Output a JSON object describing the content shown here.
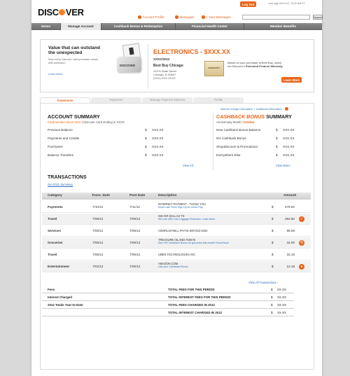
{
  "header": {
    "logo_text": "DISCOVER",
    "logout_label": "Log Out",
    "last_login": "Last login 04/11/12, 10:40 AM ET",
    "account_profile": "Account Profile",
    "messages": "Messages",
    "new_messages": "1 New Messages",
    "search_placeholder": "",
    "search_button": "Search"
  },
  "nav": [
    "Home",
    "Manage Account",
    "Cashback Bonus & Redemption",
    "Financial Health Center",
    "Member Benefits"
  ],
  "hero": {
    "title": "Value that can outstand the unexpected",
    "subtitle": "Now every Discover card purchase comes with protection",
    "learn_more": "Learn More",
    "card_text": "DISCOVER",
    "headline": "ELECTRONICS - $XXX.XX",
    "date": "XX/XX/2012",
    "store": "Best Buy Chicago",
    "addr1": "234 N State Street",
    "addr2": "Chicago, IL 60607",
    "addr3": "(XXX) XXX-XXXX",
    "warranty_label": "WARRANTY",
    "ext_text_1": "Based on your purchase at Best Buy, check out Discover's",
    "ext_text_bold": "Extended Product Warranty.",
    "button": "Learn More"
  },
  "tabs": [
    "Statements",
    "Payments",
    "Manage Payment Devices",
    "Profile"
  ],
  "top_links": [
    "Interest Charge Calculation",
    "Additional Information"
  ],
  "account_summary": {
    "title": "ACCOUNT SUMMARY",
    "cardmember_since": "Cardmember Since 2011",
    "card_ending": "Discover Card Ending in XXXX",
    "rows": [
      {
        "label": "Previous Balance",
        "cur": "$",
        "value": "XXX.XX"
      },
      {
        "label": "Payments and Credits",
        "cur": "$",
        "value": "XXX.XX"
      },
      {
        "label": "Purchases",
        "cur": "$",
        "value": "XXX.XX"
      },
      {
        "label": "Balance Transfers",
        "cur": "$",
        "value": "XXX.XX"
      }
    ],
    "view_all": "View All ›"
  },
  "cashback_summary": {
    "title_hl": "CASHBACK BONUS",
    "title_rest": " SUMMARY",
    "anniv_label": "Anniversary Month:",
    "anniv_month": "October",
    "rows": [
      {
        "label": "New Cashback Bonus Balance",
        "cur": "$",
        "value": "XXX.XX"
      },
      {
        "label": "5% Cashback Bonus",
        "cur": "$",
        "value": "XXX.XX"
      },
      {
        "label": "ShopDiscover & Promotional",
        "cur": "$",
        "value": "XXX.XX"
      },
      {
        "label": "Everywhere Else",
        "cur": "$",
        "value": "XXX.XX"
      }
    ],
    "view_more": "View More ›"
  },
  "transactions": {
    "title": "TRANSACTIONS",
    "link": "Get 2011 Summary",
    "headers": [
      "Category",
      "Trans. Date",
      "Post Date",
      "Description",
      "Amount"
    ],
    "rows": [
      {
        "category": "Payments",
        "trans": "7/10/12",
        "post": "7/11/12",
        "desc": "INTERNET PAYMENT - THANK YOU",
        "sub": "Avoid Late Fees! Sign Up for Direct Pay.",
        "cur": "$",
        "amount": "478.92",
        "icon": ""
      },
      {
        "category": "Travel",
        "trans": "7/09/12",
        "post": "7/09/12",
        "desc": "SW AIR DALLAS TX",
        "sub": "We now offer Lost Luggage Protection. Learn More",
        "cur": "$",
        "amount": "292.60",
        "icon": "check-icon"
      },
      {
        "category": "Services",
        "trans": "7/08/12",
        "post": "7/08/12",
        "desc": "VZWRLSS*BILL PAYVE 800-922-0204",
        "sub": "",
        "cur": "$",
        "amount": "95.96",
        "icon": ""
      },
      {
        "category": "Groceries",
        "trans": "7/08/12",
        "post": "7/08/12",
        "desc": "TREASURE ISLAND #10575",
        "sub": "Earn 5% Cashback Bonus on groceries this month! Enroll Now!",
        "cur": "$",
        "amount": "44.00",
        "icon": "percent-icon"
      },
      {
        "category": "Travel",
        "trans": "7/06/12",
        "post": "7/06/12",
        "desc": "UBER TECHNOLOGIES INC",
        "sub": "",
        "cur": "$",
        "amount": "34.18",
        "icon": ""
      },
      {
        "category": "Entertainment",
        "trans": "7/02/12",
        "post": "7/06/12",
        "desc": "AMAZON.COM",
        "sub": "Use your Cashback Bonus",
        "cur": "$",
        "amount": "12.18",
        "icon": "tag-icon"
      }
    ],
    "view_all": "View All Transactions ›"
  },
  "fees": [
    {
      "label": "Fees",
      "right": "TOTAL FEES FOR THIS PERIOD",
      "cur": "$",
      "value": "XX.XX"
    },
    {
      "label": "Interest Charged",
      "right": "TOTAL INTEREST FEES FOR THIS PERIOD",
      "cur": "$",
      "value": "XX.XX"
    },
    {
      "label": "2012 Totals Year-to-Date",
      "right": "TOTAL FEES CHARGED IN 2012",
      "cur": "$",
      "value": "XX.XX"
    },
    {
      "label": "",
      "right": "TOTAL INTEREST CHARGED IN 2012",
      "cur": "$",
      "value": "XX.XX"
    }
  ],
  "colors": {
    "accent": "#e8651a",
    "link": "#2a6ebb",
    "nav": "#7a7a7a"
  }
}
